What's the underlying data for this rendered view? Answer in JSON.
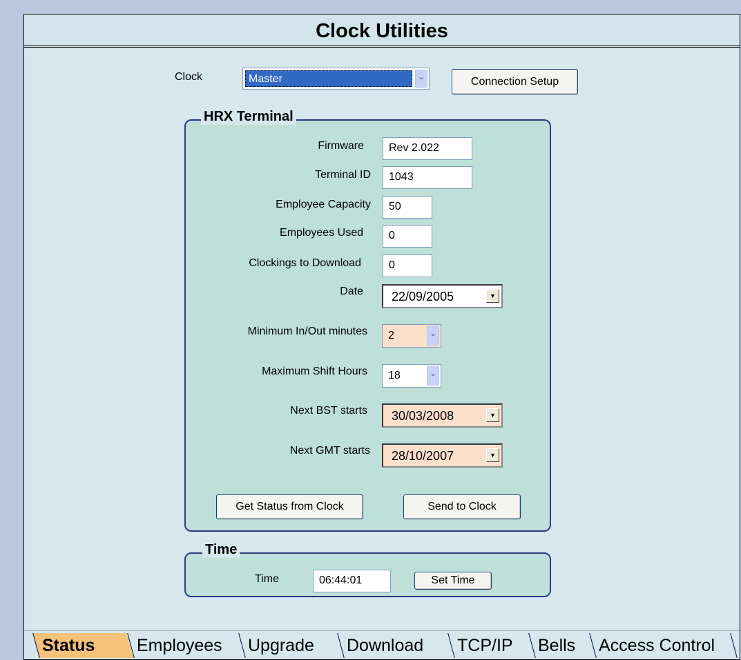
{
  "window": {
    "title": "Clock Utilities"
  },
  "clock": {
    "label": "Clock",
    "selected": "Master",
    "connection_setup_label": "Connection Setup"
  },
  "hrx_terminal": {
    "legend": "HRX Terminal",
    "firmware": {
      "label": "Firmware",
      "value": "Rev 2.022"
    },
    "terminal_id": {
      "label": "Terminal ID",
      "value": "1043"
    },
    "employee_capacity": {
      "label": "Employee Capacity",
      "value": "50"
    },
    "employees_used": {
      "label": "Employees Used",
      "value": "0"
    },
    "clockings_to_download": {
      "label": "Clockings to Download",
      "value": "0"
    },
    "date": {
      "label": "Date",
      "value": "22/09/2005"
    },
    "min_in_out": {
      "label": "Minimum In/Out minutes",
      "value": "2",
      "highlight": "#fce0cc"
    },
    "max_shift": {
      "label": "Maximum Shift Hours",
      "value": "18"
    },
    "next_bst": {
      "label": "Next BST starts",
      "value": "30/03/2008",
      "highlight": "#fce0cc"
    },
    "next_gmt": {
      "label": "Next GMT starts",
      "value": "28/10/2007",
      "highlight": "#fce0cc"
    },
    "get_status_label": "Get Status from Clock",
    "send_label": "Send to Clock"
  },
  "time_group": {
    "legend": "Time",
    "label": "Time",
    "value": "06:44:01",
    "set_time_label": "Set Time"
  },
  "tabs": [
    {
      "label": "Status",
      "active": true
    },
    {
      "label": "Employees",
      "active": false
    },
    {
      "label": "Upgrade",
      "active": false
    },
    {
      "label": "Download",
      "active": false
    },
    {
      "label": "TCP/IP",
      "active": false
    },
    {
      "label": "Bells",
      "active": false
    },
    {
      "label": "Access Control",
      "active": false
    }
  ],
  "colors": {
    "background": "#b9c8de",
    "panel": "#d6e7ee",
    "group_fill": "#bee0d8",
    "active_tab": "#f5c27a",
    "selection": "#316ac5"
  },
  "icons": [
    "chevron-down-icon",
    "dropdown-arrow-icon"
  ]
}
